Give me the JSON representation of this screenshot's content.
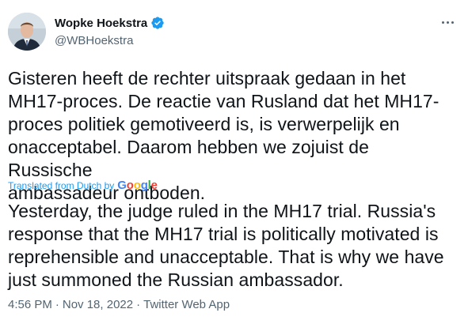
{
  "author": {
    "name": "Wopke Hoekstra",
    "handle": "@WBHoekstra",
    "verified_icon": "verified-badge-icon"
  },
  "tweet": {
    "text": "Gisteren heeft de rechter uitspraak gedaan in het\nMH17-proces. De reactie van Rusland dat het MH17-\nproces politiek gemotiveerd is, is verwerpelijk en\nonacceptabel. Daarom hebben we zojuist de Russische\nambassadeur ontboden.",
    "translated_label": "Translated from Dutch by",
    "translation_provider": "Google",
    "translation": "Yesterday, the judge ruled in the MH17 trial. Russia's\nresponse that the MH17 trial is politically motivated is\nreprehensible and unacceptable. That is why we have\njust summoned the Russian ambassador."
  },
  "meta": {
    "time": "4:56 PM",
    "date": "Nov 18, 2022",
    "source": "Twitter Web App",
    "separator": "·"
  },
  "colors": {
    "accent": "#1d9bf0",
    "text": "#0f1419",
    "secondary": "#536471"
  },
  "icons": [
    "avatar",
    "verified-badge-icon",
    "more-options-icon"
  ]
}
